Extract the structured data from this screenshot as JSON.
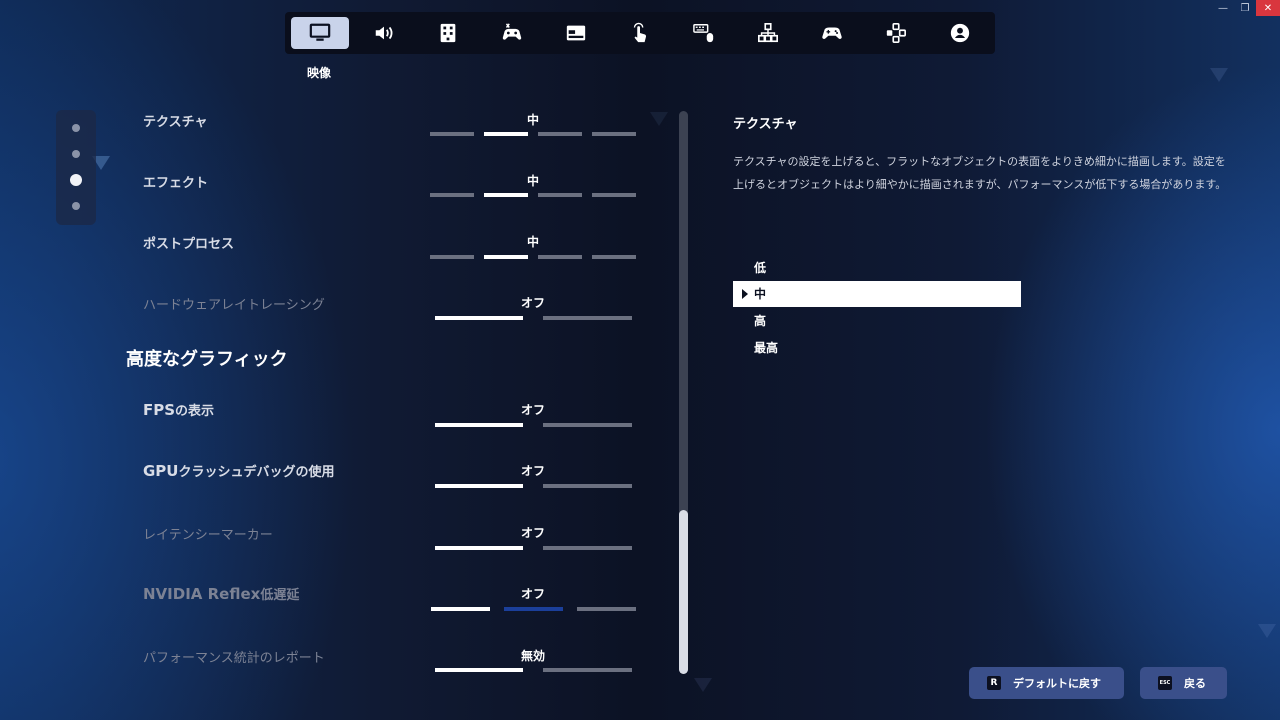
{
  "window": {
    "minimize_glyph": "—",
    "restore_glyph": "❐",
    "close_glyph": "✕"
  },
  "nav": {
    "items": [
      {
        "icon": "monitor-icon",
        "active": true
      },
      {
        "icon": "speaker-icon",
        "active": false
      },
      {
        "icon": "accessibility-grid-icon",
        "active": false
      },
      {
        "icon": "controller-settings-icon",
        "active": false
      },
      {
        "icon": "window-hud-icon",
        "active": false
      },
      {
        "icon": "touch-icon",
        "active": false
      },
      {
        "icon": "keyboard-mouse-icon",
        "active": false
      },
      {
        "icon": "hierarchy-icon",
        "active": false
      },
      {
        "icon": "gamepad-icon",
        "active": false
      },
      {
        "icon": "dpad-icon",
        "active": false
      },
      {
        "icon": "account-icon",
        "active": false
      }
    ],
    "active_label": "映像"
  },
  "settings": {
    "texture": {
      "label": "テクスチャ",
      "value": "中"
    },
    "effects": {
      "label": "エフェクト",
      "value": "中"
    },
    "post_process": {
      "label": "ポストプロセス",
      "value": "中"
    },
    "ray_tracing": {
      "label": "ハードウェアレイトレーシング",
      "value": "オフ"
    },
    "section_title": "高度なグラフィック",
    "fps": {
      "label_big": "FPS",
      "label_rest": "の表示",
      "value": "オフ"
    },
    "gpu_crash": {
      "label_big": "GPU",
      "label_rest": "クラッシュデバッグの使用",
      "value": "オフ"
    },
    "latency_marker": {
      "label": "レイテンシーマーカー",
      "value": "オフ"
    },
    "reflex": {
      "label_big": "NVIDIA Reflex",
      "label_rest": "低遅延",
      "value": "オフ"
    },
    "perf_report": {
      "label": "パフォーマンス統計のレポート",
      "value": "無効"
    }
  },
  "description": {
    "title": "テクスチャ",
    "body": "テクスチャの設定を上げると、フラットなオブジェクトの表面をよりきめ細かに描画します。設定を上げるとオブジェクトはより細やかに描画されますが、パフォーマンスが低下する場合があります。",
    "options": [
      "低",
      "中",
      "高",
      "最高"
    ],
    "selected_index": 1
  },
  "buttons": {
    "reset": {
      "key": "R",
      "label": "デフォルトに戻す"
    },
    "back": {
      "key": "ESC",
      "label": "戻る"
    }
  },
  "colors": {
    "accent_blue": "#1b3f9a",
    "button_bg": "#3a4f8a",
    "close_red": "#d9363e"
  }
}
